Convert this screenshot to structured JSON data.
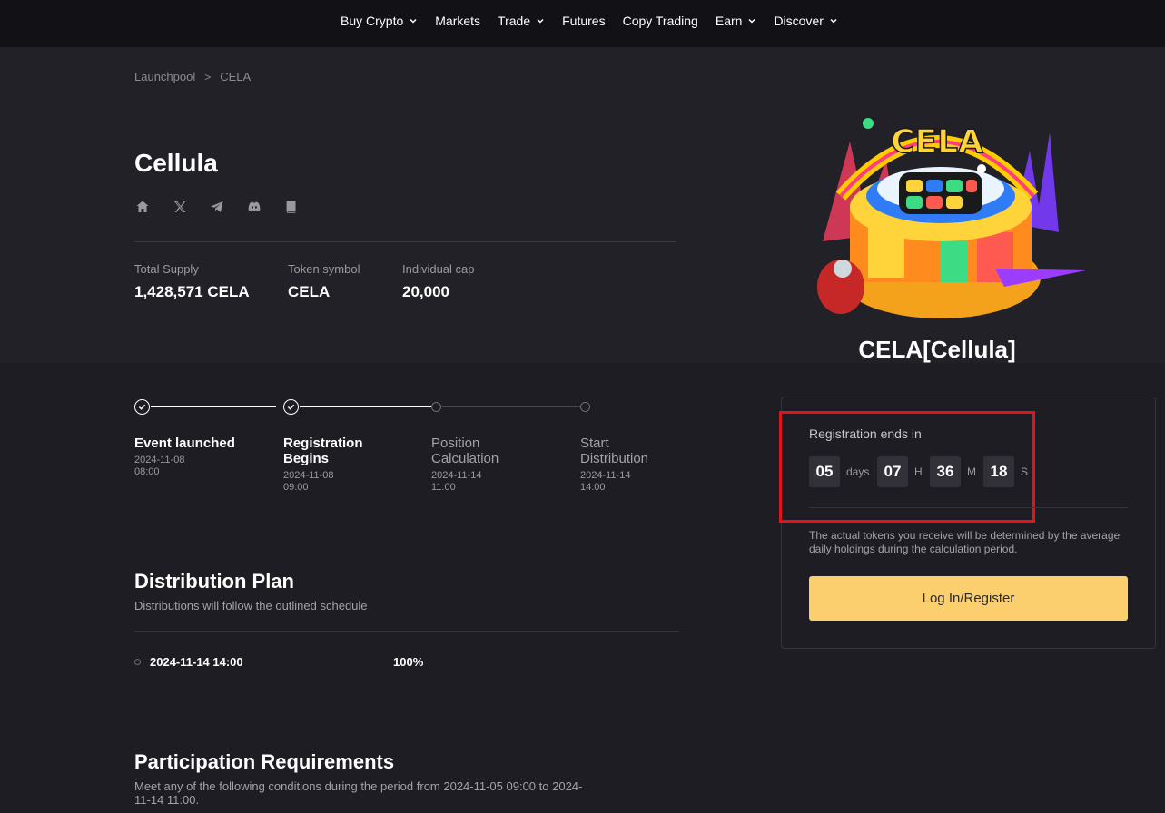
{
  "nav": {
    "items": [
      {
        "label": "Buy Crypto",
        "dropdown": true
      },
      {
        "label": "Markets",
        "dropdown": false
      },
      {
        "label": "Trade",
        "dropdown": true
      },
      {
        "label": "Futures",
        "dropdown": false
      },
      {
        "label": "Copy Trading",
        "dropdown": false
      },
      {
        "label": "Earn",
        "dropdown": true
      },
      {
        "label": "Discover",
        "dropdown": true
      }
    ]
  },
  "breadcrumb": {
    "parent": "Launchpool",
    "separator": ">",
    "current": "CELA"
  },
  "project": {
    "name": "Cellula",
    "socials": [
      "home-icon",
      "x-icon",
      "telegram-icon",
      "discord-icon",
      "docs-icon"
    ],
    "stats": [
      {
        "label": "Total Supply",
        "value": "1,428,571 CELA"
      },
      {
        "label": "Token symbol",
        "value": "CELA"
      },
      {
        "label": "Individual cap",
        "value": "20,000"
      }
    ],
    "art_title": "CELA[Cellula]",
    "art_logo_text": "CELA"
  },
  "timeline": [
    {
      "title": "Event launched",
      "date": "2024-11-08 08:00",
      "done": true
    },
    {
      "title": "Registration Begins",
      "date": "2024-11-08 09:00",
      "done": true
    },
    {
      "title": "Position Calculation",
      "date": "2024-11-14 11:00",
      "done": false
    },
    {
      "title": "Start Distribution",
      "date": "2024-11-14 14:00",
      "done": false
    }
  ],
  "registration": {
    "label": "Registration ends in",
    "countdown": {
      "days": "05",
      "days_unit": "days",
      "hours": "07",
      "hours_unit": "H",
      "minutes": "36",
      "minutes_unit": "M",
      "seconds": "18",
      "seconds_unit": "S"
    },
    "note": "The actual tokens you receive will be determined by the average daily holdings during the calculation period.",
    "button": "Log In/Register"
  },
  "distribution": {
    "title": "Distribution Plan",
    "subtitle": "Distributions will follow the outlined schedule",
    "rows": [
      {
        "date": "2024-11-14 14:00",
        "percent": "100%"
      }
    ]
  },
  "participation": {
    "title": "Participation Requirements",
    "subtitle": "Meet any of the following conditions during the period from 2024-11-05 09:00 to 2024-11-14 11:00."
  },
  "colors": {
    "accent_button": "#fbcf6e",
    "highlight_box": "#e0141d",
    "page_bg": "#1f1d24",
    "nav_bg": "#121116"
  }
}
